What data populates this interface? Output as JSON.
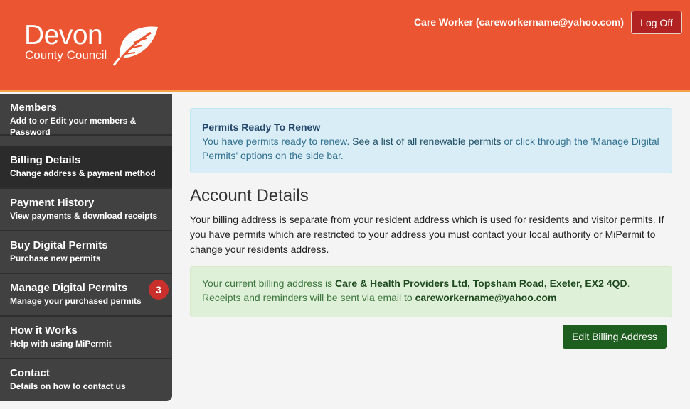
{
  "header": {
    "logo_line1": "Devon",
    "logo_line2": "County Council",
    "user": "Care Worker (careworkername@yahoo.com)",
    "logoff_label": "Log Off",
    "bg_color": "#eb5531",
    "accent_color": "#f2a24b"
  },
  "sidebar": {
    "items": [
      {
        "title": "Members",
        "subtitle": "Add to or Edit your members & Password"
      },
      {
        "title": "Billing Details",
        "subtitle": "Change address & payment method"
      },
      {
        "title": "Payment History",
        "subtitle": "View payments & download receipts"
      },
      {
        "title": "Buy Digital Permits",
        "subtitle": "Purchase new permits"
      },
      {
        "title": "Manage Digital Permits",
        "subtitle": "Manage your purchased permits",
        "badge": "3"
      },
      {
        "title": "How it Works",
        "subtitle": "Help with using MiPermit"
      },
      {
        "title": "Contact",
        "subtitle": "Details on how to contact us"
      }
    ]
  },
  "main": {
    "renew_alert": {
      "heading": "Permits Ready To Renew",
      "text_before": "You have permits ready to renew. ",
      "link": "See a list of all renewable permits",
      "text_after": " or click through the 'Manage Digital Permits' options on the side bar."
    },
    "section_title": "Account Details",
    "description": "Your billing address is separate from your resident address which is used for residents and visitor permits. If you have permits which are restricted to your address you must contact your local authority or MiPermit to change your residents address.",
    "billing_alert": {
      "text1": "Your current billing address is ",
      "address": "Care & Health Providers Ltd, Topsham Road, Exeter, EX2 4QD",
      "text2": ". Receipts and reminders will be sent via email to ",
      "email": "careworkername@yahoo.com"
    },
    "edit_button": "Edit Billing Address"
  }
}
